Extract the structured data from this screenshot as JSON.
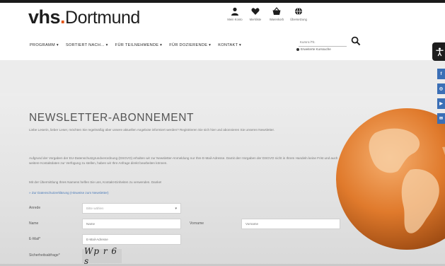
{
  "logo": {
    "vhs": "vhs",
    "dot": ".",
    "city": "Dortmund"
  },
  "quicklinks": [
    {
      "label": "Mein Konto",
      "icon": "user-icon"
    },
    {
      "label": "Merkliste",
      "icon": "heart-icon"
    },
    {
      "label": "Warenkorb",
      "icon": "basket-icon"
    },
    {
      "label": "Übersetzung",
      "icon": "globe-icon"
    }
  ],
  "nav": [
    "PROGRAMM ▾",
    "SORTIERT NACH... ▾",
    "FÜR TEILNEHMENDE ▾",
    "FÜR DOZIERENDE ▾",
    "KONTAKT ▾"
  ],
  "search": {
    "placeholder": "Kursnr./Tit.",
    "advanced": "Erweiterte Kurssuche"
  },
  "page": {
    "title": "NEWSLETTER-ABONNEMENT",
    "intro": "Liebe Leserin, lieber Leser, möchten Sie regelmäßig über unsere aktuellen Angebote informiert werden? Registrieren Sie sich hier und abonnieren Sie unseren Newsletter.",
    "privacy": "Aufgrund der Vorgaben der EU-Datenschutzgrundverordnung (DSGVO) erhalten wir zur Newsletter-Anmeldung nur Ihre E-Mail-Adresse. Damit den Vorgaben der DSGVO nicht in Ihrem Handeln keine Frist und auch weitere Kontaktdaten zur Verfügung zu stellen, haben wir Ihre Anfrage direkt bearbeiten können.",
    "required": "Mit der Übermittlung Ihres Namens helfen Sie uns, Kontakt-Einheiten zu verwenden. Danke!",
    "link": "» Zur Datenschutzerklärung (Hinweise zum Newsletter)"
  },
  "form": {
    "anrede_label": "Anrede",
    "anrede_value": "Bitte wählen",
    "name_label": "Name",
    "name_placeholder": "Name",
    "vorname_label": "Vorname",
    "vorname_placeholder": "Vorname",
    "email_label": "E-Mail*",
    "email_placeholder": "E-Mail-Adresse",
    "captcha_label": "Sicherheitsabfrage*",
    "captcha_text": "Wp r 6 s"
  },
  "social": [
    "f",
    "◎",
    "▶",
    "✉"
  ],
  "colors": {
    "brand_orange": "#e2571c",
    "social_blue": "#3b6fb6",
    "link_blue": "#4a7ab8"
  }
}
